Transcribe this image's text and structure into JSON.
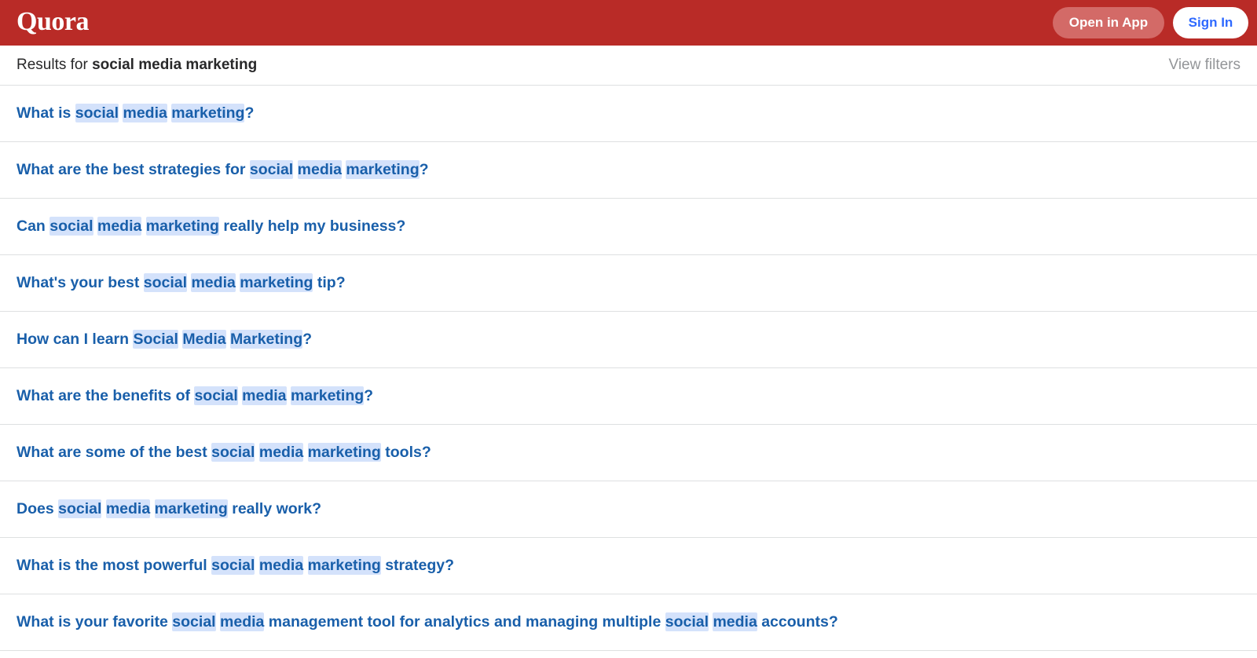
{
  "header": {
    "logo": "Quora",
    "open_in_app_label": "Open in App",
    "sign_in_label": "Sign In"
  },
  "results_bar": {
    "prefix": "Results for",
    "query": "social media marketing",
    "view_filters_label": "View filters"
  },
  "colors": {
    "brand_red": "#b92b27",
    "link_blue": "#195faa",
    "highlight": "#d4e2fb",
    "sign_in_text": "#2e69ff"
  },
  "results": [
    {
      "segments": [
        {
          "t": "What is ",
          "h": false
        },
        {
          "t": "social",
          "h": true
        },
        {
          "t": " ",
          "h": false
        },
        {
          "t": "media",
          "h": true
        },
        {
          "t": " ",
          "h": false
        },
        {
          "t": "marketing",
          "h": true
        },
        {
          "t": "?",
          "h": false
        }
      ]
    },
    {
      "segments": [
        {
          "t": "What are the best strategies for ",
          "h": false
        },
        {
          "t": "social",
          "h": true
        },
        {
          "t": " ",
          "h": false
        },
        {
          "t": "media",
          "h": true
        },
        {
          "t": " ",
          "h": false
        },
        {
          "t": "marketing",
          "h": true
        },
        {
          "t": "?",
          "h": false
        }
      ]
    },
    {
      "segments": [
        {
          "t": "Can ",
          "h": false
        },
        {
          "t": "social",
          "h": true
        },
        {
          "t": " ",
          "h": false
        },
        {
          "t": "media",
          "h": true
        },
        {
          "t": " ",
          "h": false
        },
        {
          "t": "marketing",
          "h": true
        },
        {
          "t": " really help my business?",
          "h": false
        }
      ]
    },
    {
      "segments": [
        {
          "t": "What's your best ",
          "h": false
        },
        {
          "t": "social",
          "h": true
        },
        {
          "t": " ",
          "h": false
        },
        {
          "t": "media",
          "h": true
        },
        {
          "t": " ",
          "h": false
        },
        {
          "t": "marketing",
          "h": true
        },
        {
          "t": " tip?",
          "h": false
        }
      ]
    },
    {
      "segments": [
        {
          "t": "How can I learn ",
          "h": false
        },
        {
          "t": "Social",
          "h": true
        },
        {
          "t": " ",
          "h": false
        },
        {
          "t": "Media",
          "h": true
        },
        {
          "t": " ",
          "h": false
        },
        {
          "t": "Marketing",
          "h": true
        },
        {
          "t": "?",
          "h": false
        }
      ]
    },
    {
      "segments": [
        {
          "t": "What are the benefits of ",
          "h": false
        },
        {
          "t": "social",
          "h": true
        },
        {
          "t": " ",
          "h": false
        },
        {
          "t": "media",
          "h": true
        },
        {
          "t": " ",
          "h": false
        },
        {
          "t": "marketing",
          "h": true
        },
        {
          "t": "?",
          "h": false
        }
      ]
    },
    {
      "segments": [
        {
          "t": "What are some of the best ",
          "h": false
        },
        {
          "t": "social",
          "h": true
        },
        {
          "t": " ",
          "h": false
        },
        {
          "t": "media",
          "h": true
        },
        {
          "t": " ",
          "h": false
        },
        {
          "t": "marketing",
          "h": true
        },
        {
          "t": " tools?",
          "h": false
        }
      ]
    },
    {
      "segments": [
        {
          "t": "Does ",
          "h": false
        },
        {
          "t": "social",
          "h": true
        },
        {
          "t": " ",
          "h": false
        },
        {
          "t": "media",
          "h": true
        },
        {
          "t": " ",
          "h": false
        },
        {
          "t": "marketing",
          "h": true
        },
        {
          "t": " really work?",
          "h": false
        }
      ]
    },
    {
      "segments": [
        {
          "t": "What is the most powerful ",
          "h": false
        },
        {
          "t": "social",
          "h": true
        },
        {
          "t": " ",
          "h": false
        },
        {
          "t": "media",
          "h": true
        },
        {
          "t": " ",
          "h": false
        },
        {
          "t": "marketing",
          "h": true
        },
        {
          "t": " strategy?",
          "h": false
        }
      ]
    },
    {
      "segments": [
        {
          "t": "What is your favorite ",
          "h": false
        },
        {
          "t": "social",
          "h": true
        },
        {
          "t": " ",
          "h": false
        },
        {
          "t": "media",
          "h": true
        },
        {
          "t": " management tool for analytics and managing multiple ",
          "h": false
        },
        {
          "t": "social",
          "h": true
        },
        {
          "t": " ",
          "h": false
        },
        {
          "t": "media",
          "h": true
        },
        {
          "t": " accounts?",
          "h": false
        }
      ]
    }
  ]
}
